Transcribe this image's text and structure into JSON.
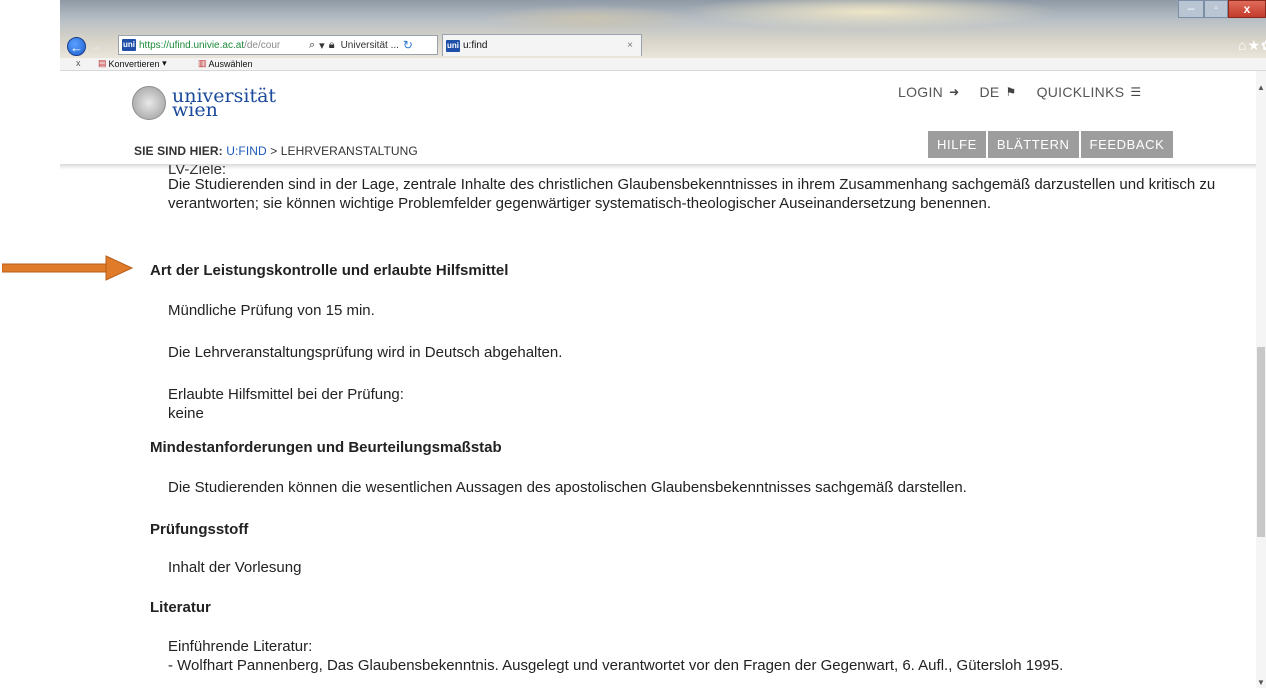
{
  "browser": {
    "url_host": "https://ufind.univie.ac.at",
    "url_path": "/de/cour",
    "site_identity": "Universität ...",
    "tab_title": "u:find",
    "tab_close": "×",
    "window_controls": {
      "minimize": "–",
      "maximize": "▫",
      "close": "x"
    },
    "nav_icons": "⌂★✿",
    "favicon": "uni"
  },
  "command_bar": {
    "close": "x",
    "convert_label": "Konvertieren",
    "select_label": "Auswählen"
  },
  "header": {
    "logo_line1": "universität",
    "logo_line2": "wien",
    "top_links": {
      "login": "LOGIN",
      "language": "DE",
      "quicklinks": "QUICKLINKS"
    },
    "breadcrumb": {
      "label": "SIE SIND HIER:",
      "link": "U:FIND",
      "separator": ">",
      "current": "LEHRVERANSTALTUNG"
    },
    "buttons": [
      "HILFE",
      "BLÄTTERN",
      "FEEDBACK"
    ]
  },
  "content": {
    "ev_ziele_label": "LV-Ziele:",
    "lernziel_text": "Die Studierenden sind in der Lage, zentrale Inhalte des christlichen Glaubensbekenntnisses in ihrem Zusammenhang sachgemäß darzustellen und kritisch zu verantworten; sie können wichtige Problemfelder gegenwärtiger systematisch-theologischer Auseinandersetzung benennen.",
    "sections": [
      {
        "heading": "Art der Leistungskontrolle und erlaubte Hilfsmittel",
        "paragraphs": [
          "Mündliche Prüfung von 15 min.",
          "Die Lehrveranstaltungsprüfung wird in Deutsch abgehalten.",
          "Erlaubte Hilfsmittel bei der Prüfung:",
          "keine"
        ]
      },
      {
        "heading": "Mindestanforderungen und Beurteilungsmaßstab",
        "paragraphs": [
          "Die Studierenden können die wesentlichen Aussagen des apostolischen Glaubensbekenntnisses sachgemäß darstellen."
        ]
      },
      {
        "heading": "Prüfungsstoff",
        "paragraphs": [
          "Inhalt der Vorlesung"
        ]
      },
      {
        "heading": "Literatur",
        "paragraphs": [
          "Einführende Literatur:",
          "- Wolfhart Pannenberg, Das Glaubensbekenntnis. Ausgelegt und verantwortet vor den Fragen der Gegenwart, 6. Aufl., Gütersloh 1995."
        ]
      }
    ]
  },
  "colors": {
    "link_blue": "#1f5ab8",
    "logo_blue": "#1b4a9c",
    "header_button_gray": "#9d9d9d",
    "annotation_arrow": "#e07b2a"
  }
}
